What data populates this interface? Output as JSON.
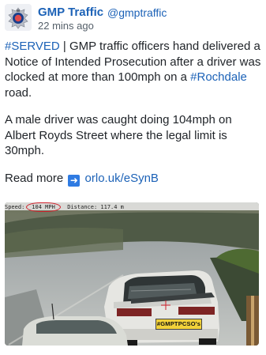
{
  "account": {
    "display_name": "GMP Traffic",
    "handle": "@gmptraffic",
    "time_ago": "22 mins ago",
    "avatar_icon": "police-badge-icon"
  },
  "post": {
    "hashtag_served": "#SERVED",
    "para1_rest": " | GMP traffic officers hand delivered a Notice of Intended Prosecution after a driver was clocked at more than 100mph on a ",
    "hashtag_rochdale": "#Rochdale",
    "para1_end": " road.",
    "para2": "A male driver was caught doing 104mph on Albert Royds Street where the legal limit is 30mph.",
    "read_more": "Read more",
    "arrow_icon": "right-arrow-icon",
    "link": "orlo.uk/eSynB"
  },
  "media": {
    "speed_label": "Speed:",
    "speed_value": "104 MPH",
    "distance": "Distance: 117.4 m",
    "plate": "#GMPTPCSO's"
  },
  "colors": {
    "link": "#1c62b7",
    "accent_red": "#d0202b",
    "plate_yellow": "#f2d23a"
  }
}
